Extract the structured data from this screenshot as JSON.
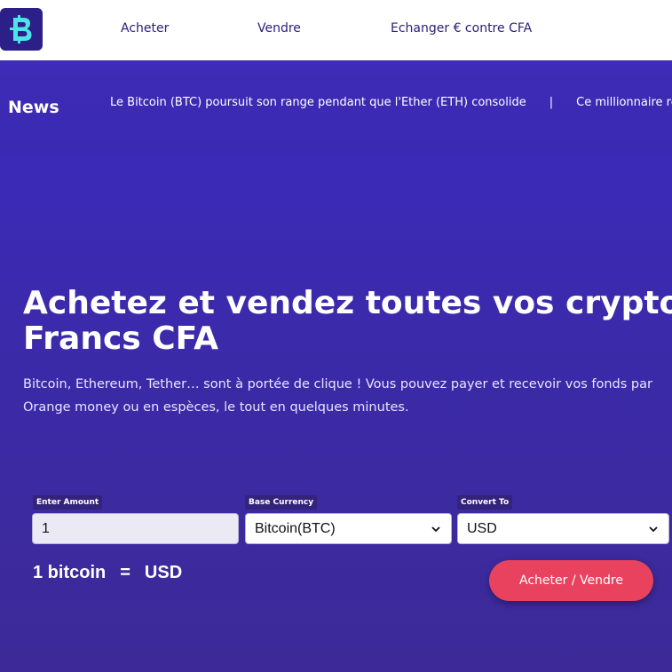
{
  "header": {
    "nav": [
      {
        "label": "Acheter"
      },
      {
        "label": "Vendre"
      },
      {
        "label": "Echanger € contre CFA"
      }
    ]
  },
  "news": {
    "title": "News",
    "items": [
      "Le Bitcoin (BTC) poursuit son range pendant que l'Ether (ETH) consolide",
      "Ce millionnaire rêve"
    ],
    "separator": "|"
  },
  "hero": {
    "title_line1": "Achetez et vendez toutes vos cryptos en",
    "title_line2": "Francs CFA",
    "subtitle": "Bitcoin, Ethereum, Tether… sont à portée de clique ! Vous pouvez payer et recevoir vos fonds par Orange money ou en espèces, le tout en quelques minutes."
  },
  "converter": {
    "amount_label": "Enter Amount",
    "amount_value": "1",
    "base_label": "Base Currency",
    "base_value": "Bitcoin(BTC)",
    "convert_label": "Convert To",
    "convert_value": "USD",
    "result_left": "1 bitcoin",
    "result_eq": "=",
    "result_right": "USD",
    "cta_label": "Acheter / Vendre"
  },
  "colors": {
    "brand": "#2d1f88",
    "logo_accent": "#4fe3e8",
    "hero_bg": "#3b2ab8",
    "cta": "#e8425f",
    "nav_text": "#2a2278"
  }
}
